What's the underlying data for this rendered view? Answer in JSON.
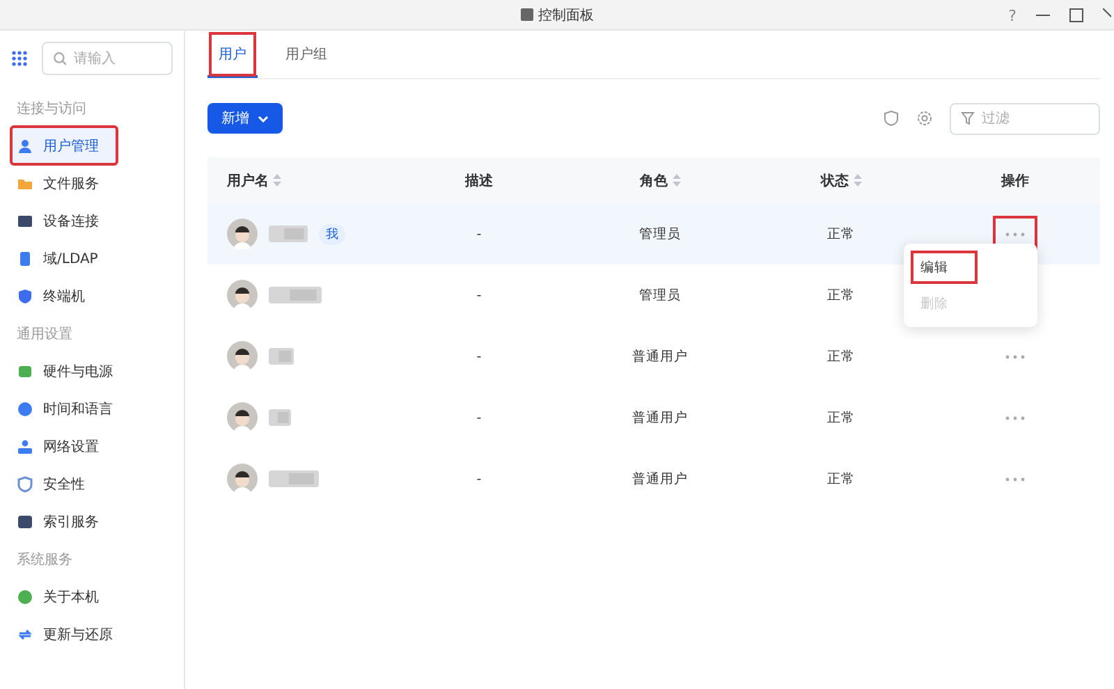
{
  "window": {
    "title": "控制面板",
    "controls": [
      "?"
    ]
  },
  "sidebar": {
    "search": {
      "placeholder": "请输入"
    },
    "sections": [
      {
        "title": "连接与访问",
        "items": [
          {
            "label": "用户管理",
            "kind": "user",
            "selected": true,
            "annotated": true
          },
          {
            "label": "文件服务",
            "kind": "folder",
            "selected": false,
            "annotated": false
          },
          {
            "label": "设备连接",
            "kind": "monitor",
            "selected": false,
            "annotated": false
          },
          {
            "label": "域/LDAP",
            "kind": "domain",
            "selected": false,
            "annotated": false
          },
          {
            "label": "终端机",
            "kind": "shield",
            "selected": false,
            "annotated": false
          }
        ]
      },
      {
        "title": "通用设置",
        "items": [
          {
            "label": "硬件与电源",
            "kind": "battery",
            "selected": false,
            "annotated": false
          },
          {
            "label": "时间和语言",
            "kind": "globe",
            "selected": false,
            "annotated": false
          },
          {
            "label": "网络设置",
            "kind": "network",
            "selected": false,
            "annotated": false
          },
          {
            "label": "安全性",
            "kind": "security",
            "selected": false,
            "annotated": false
          },
          {
            "label": "索引服务",
            "kind": "index",
            "selected": false,
            "annotated": false
          }
        ]
      },
      {
        "title": "系统服务",
        "items": [
          {
            "label": "关于本机",
            "kind": "info",
            "selected": false,
            "annotated": false
          },
          {
            "label": "更新与还原",
            "kind": "sync",
            "selected": false,
            "annotated": false
          }
        ]
      }
    ]
  },
  "tabs": [
    {
      "label": "用户",
      "selected": true,
      "annotated": true
    },
    {
      "label": "用户组",
      "selected": false,
      "annotated": false
    }
  ],
  "toolbar": {
    "add_button": "新增",
    "filter": {
      "placeholder": "过滤"
    }
  },
  "table": {
    "columns": [
      "用户名",
      "描述",
      "角色",
      "状态",
      "操作"
    ],
    "rows": [
      {
        "badge": "我",
        "description": "-",
        "role": "管理员",
        "status": "正常",
        "selected": true,
        "annotated": true
      },
      {
        "description": "-",
        "role": "管理员",
        "status": "正常",
        "selected": false
      },
      {
        "description": "-",
        "role": "普通用户",
        "status": "正常",
        "selected": false,
        "annotated": false
      },
      {
        "description": "-",
        "role": "普通用户",
        "status": "正常",
        "selected": false,
        "annotated": false
      },
      {
        "description": "-",
        "role": "普通用户",
        "status": "正常",
        "selected": false,
        "annotated": false
      }
    ]
  },
  "row_menu": {
    "items": [
      {
        "label": "编辑",
        "disabled": false,
        "annotated": true
      },
      {
        "label": "删除",
        "disabled": true,
        "annotated": false
      }
    ]
  }
}
